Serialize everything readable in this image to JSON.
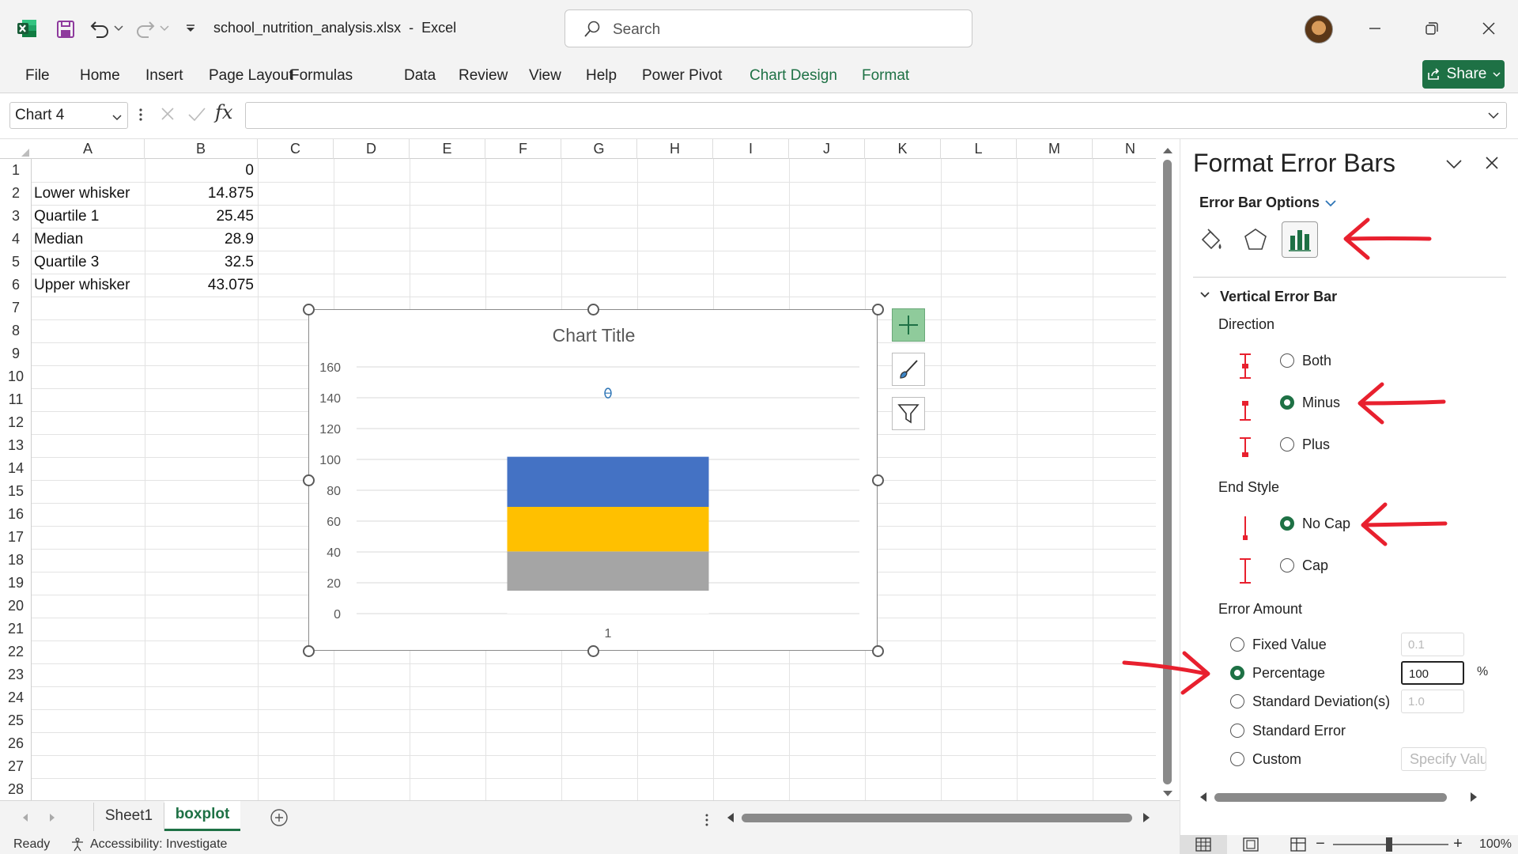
{
  "titlebar": {
    "file_name": "school_nutrition_analysis.xlsx",
    "separator": "-",
    "app_name": "Excel",
    "search_placeholder": "Search"
  },
  "ribbon": {
    "tabs": [
      "File",
      "Home",
      "Insert",
      "Page Layout",
      "Formulas",
      "Data",
      "Review",
      "View",
      "Help",
      "Power Pivot",
      "Chart Design",
      "Format"
    ],
    "share_label": "Share"
  },
  "formula_bar": {
    "name_box": "Chart 4",
    "fx": "fx",
    "formula": ""
  },
  "sheet": {
    "columns": [
      "A",
      "B",
      "C",
      "D",
      "E",
      "F",
      "G",
      "H",
      "I",
      "J",
      "K",
      "L",
      "M",
      "N"
    ],
    "rows": [
      "1",
      "2",
      "3",
      "4",
      "5",
      "6",
      "7",
      "8",
      "9",
      "10",
      "11",
      "12",
      "13",
      "14",
      "15",
      "16",
      "17",
      "18",
      "19",
      "20",
      "21",
      "22",
      "23",
      "24",
      "25",
      "26",
      "27",
      "28"
    ],
    "cells": [
      {
        "label": "",
        "value": "0"
      },
      {
        "label": "Lower whisker",
        "value": "14.875"
      },
      {
        "label": "Quartile 1",
        "value": "25.45"
      },
      {
        "label": "Median",
        "value": "28.9"
      },
      {
        "label": "Quartile 3",
        "value": "32.5"
      },
      {
        "label": "Upper whisker",
        "value": "43.075"
      }
    ]
  },
  "chart_data": {
    "type": "bar",
    "title": "Chart Title",
    "categories": [
      "1"
    ],
    "ylim": [
      0,
      160
    ],
    "yticks": [
      "0",
      "20",
      "40",
      "60",
      "80",
      "100",
      "120",
      "140",
      "160"
    ],
    "grid": true,
    "stacked": true,
    "series": [
      {
        "values": [
          14.875
        ],
        "color": "#ffffff"
      },
      {
        "values": [
          25.45
        ],
        "color": "#a5a5a5"
      },
      {
        "values": [
          28.9
        ],
        "color": "#ffc000"
      },
      {
        "values": [
          32.5
        ],
        "color": "#4472c4"
      }
    ],
    "error_bar_end": 143
  },
  "sheet_tabs": {
    "tabs": [
      "Sheet1",
      "boxplot"
    ],
    "active": "boxplot"
  },
  "status": {
    "ready": "Ready",
    "accessibility": "Accessibility: Investigate",
    "zoom": "100%",
    "zoom_out": "−",
    "zoom_in": "+"
  },
  "pane": {
    "title": "Format Error Bars",
    "options_label": "Error Bar Options",
    "section": "Vertical Error Bar",
    "direction_label": "Direction",
    "direction": {
      "both": "Both",
      "minus": "Minus",
      "plus": "Plus",
      "selected": "Minus"
    },
    "end_style_label": "End Style",
    "end_style": {
      "no_cap": "No Cap",
      "cap": "Cap",
      "selected": "No Cap"
    },
    "error_amount_label": "Error Amount",
    "error_amount": {
      "fixed_value": "Fixed Value",
      "fixed_value_input": "0.1",
      "percentage": "Percentage",
      "percentage_input": "100",
      "percent_sign": "%",
      "std_dev": "Standard Deviation(s)",
      "std_dev_input": "1.0",
      "std_error": "Standard Error",
      "custom": "Custom",
      "specify_value": "Specify Value",
      "selected": "Percentage"
    }
  },
  "colors": {
    "accent": "#1e7145",
    "annotation_arrow": "#e8202e",
    "chart_blue": "#4472c4",
    "chart_gold": "#ffc000",
    "chart_gray": "#a5a5a5",
    "error_bar": "#2e75b6"
  }
}
